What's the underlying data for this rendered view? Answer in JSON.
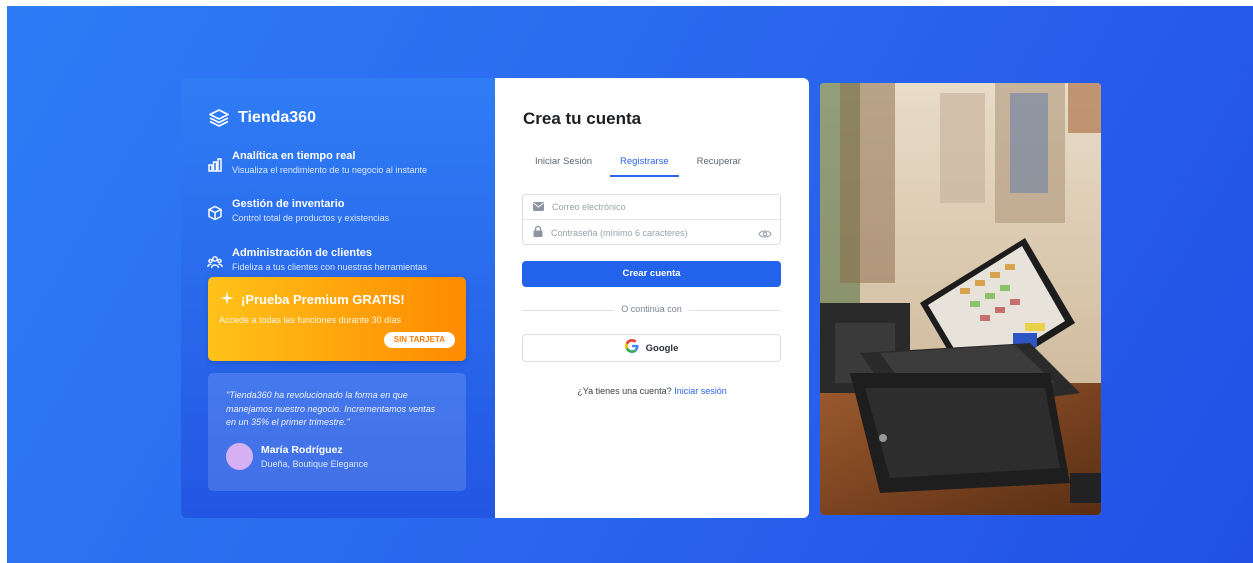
{
  "brand": {
    "name": "Tienda360",
    "icon": "layers-icon"
  },
  "features": [
    {
      "icon": "chart-icon",
      "title": "Analítica en tiempo real",
      "desc": "Visualiza el rendimiento de tu negocio al instante"
    },
    {
      "icon": "box-icon",
      "title": "Gestión de inventario",
      "desc": "Control total de productos y existencias"
    },
    {
      "icon": "users-icon",
      "title": "Administración de clientes",
      "desc": "Fideliza a tus clientes con nuestras herramientas"
    }
  ],
  "promo": {
    "title": "¡Prueba Premium GRATIS!",
    "subtitle": "Accede a todas las funciones durante 30 días",
    "badge": "SIN TARJETA",
    "icon": "sparkle-icon"
  },
  "testimonial": {
    "quote": "\"Tienda360 ha revolucionado la forma en que manejamos nuestro negocio. Incrementamos ventas en un 35% el primer trimestre.\"",
    "name": "María Rodríguez",
    "role": "Dueña, Boutique Elegance"
  },
  "form": {
    "title": "Crea tu cuenta",
    "tabs": [
      "Iniciar Sesión",
      "Registrarse",
      "Recuperar"
    ],
    "active_tab": "Registrarse",
    "email_placeholder": "Correo electrónico",
    "password_placeholder": "Contraseña (mínimo 6 caracteres)",
    "submit": "Crear cuenta",
    "divider": "O continúa con",
    "google": "Google",
    "signin_text": "¿Ya tienes una cuenta?",
    "signin_link": "Iniciar sesión"
  },
  "photo": {
    "alt": "pos-terminal-image"
  }
}
